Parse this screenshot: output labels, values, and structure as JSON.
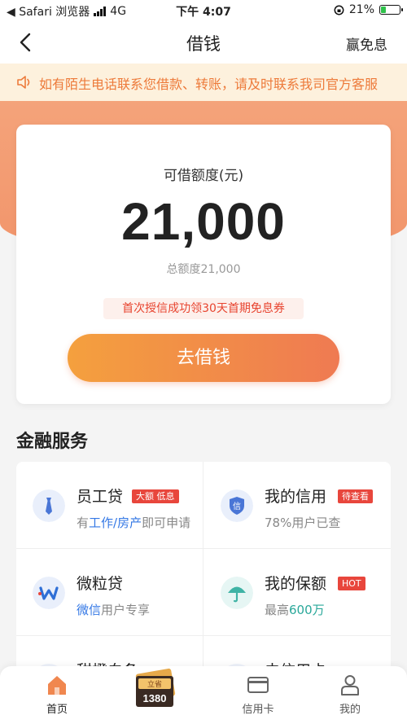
{
  "status_bar": {
    "back_app": "◀ Safari 浏览器",
    "network": "4G",
    "time": "下午 4:07",
    "battery_percent": "21%"
  },
  "nav": {
    "title": "借钱",
    "right_action": "赢免息"
  },
  "notice": {
    "text": "如有陌生电话联系您借款、转账，请及时联系我司官方客服"
  },
  "loan_card": {
    "label": "可借额度(元)",
    "amount": "21,000",
    "total": "总额度21,000",
    "coupon": "首次授信成功领30天首期免息券",
    "button": "去借钱"
  },
  "finance": {
    "title": "金融服务",
    "items": [
      {
        "title": "员工贷",
        "badge": "大额 低息",
        "sub_pre": "有",
        "sub_hl1": "工作",
        "sub_sep": "/",
        "sub_hl2": "房产",
        "sub_post": "即可申请",
        "icon": "tie-icon"
      },
      {
        "title": "我的信用",
        "badge": "待查看",
        "sub": "78%用户已查",
        "icon": "credit-shield-icon"
      },
      {
        "title": "微粒贷",
        "sub_hl1": "微信",
        "sub_post": "用户专享",
        "icon": "weilidai-icon"
      },
      {
        "title": "我的保额",
        "badge": "HOT",
        "sub_pre": "最高",
        "sub_hl1": "600万",
        "icon": "umbrella-icon"
      },
      {
        "title": "甜橙白条",
        "icon": "partial-icon"
      },
      {
        "title": "去信用卡",
        "icon": "partial-icon"
      }
    ]
  },
  "promo": {
    "label": "立省",
    "value": "1380"
  },
  "tabs": [
    {
      "label": "首页",
      "icon": "home-icon",
      "active": true
    },
    {
      "label": "信用卡",
      "icon": "credit-card-icon"
    },
    {
      "label": "我的",
      "icon": "user-icon"
    }
  ],
  "colors": {
    "accent": "#ef7a52",
    "badge": "#e8463c",
    "link": "#3478e5"
  }
}
